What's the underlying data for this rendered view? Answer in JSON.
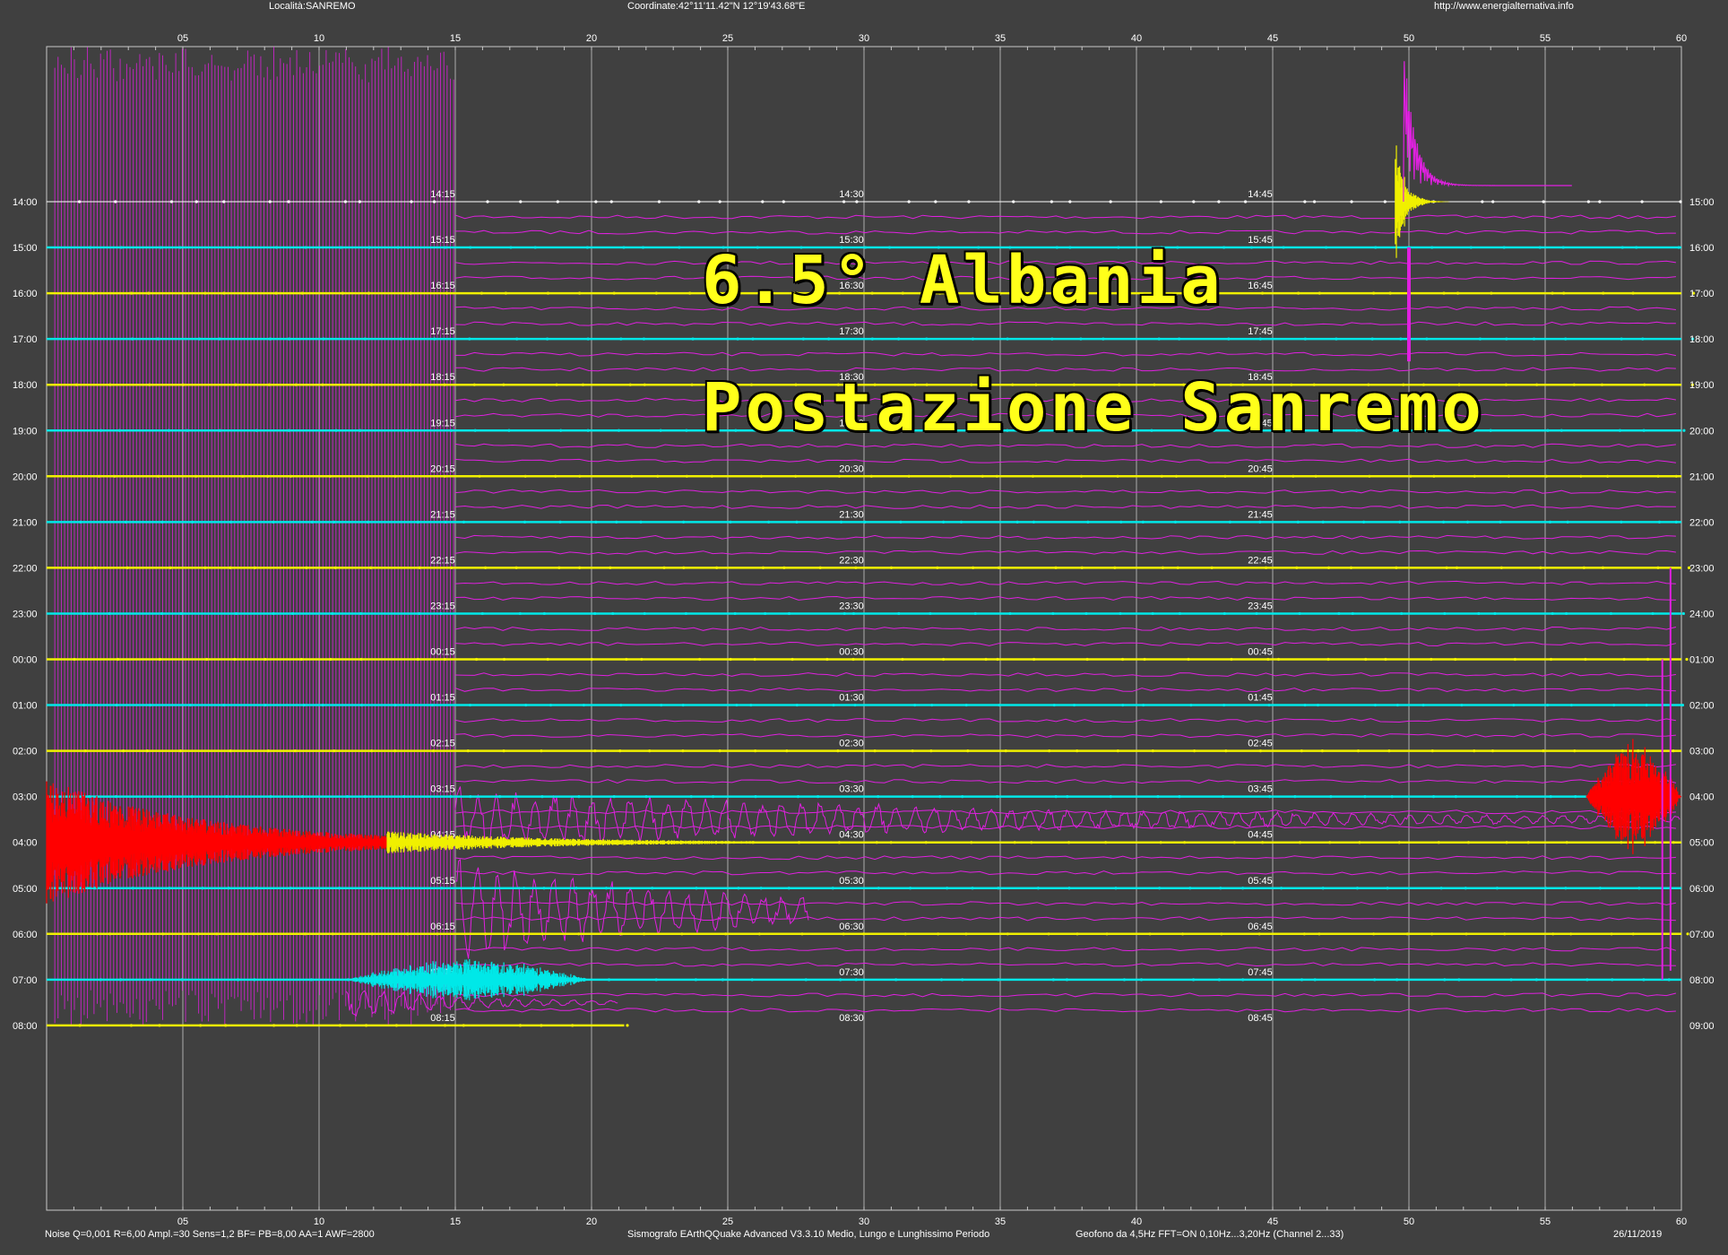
{
  "header": {
    "location": "Località:SANREMO",
    "coordinates": "Coordinate:42°11'11.42\"N  12°19'43.68\"E",
    "url": "http://www.energialternativa.info"
  },
  "footer": {
    "settings": "Noise Q=0,001 R=6,00 Ampl.=30 Sens=1,2 BF= PB=8,00 AA=1 AWF=2800",
    "software": "Sismografo  EArthQQuake Advanced V3.3.10  Medio, Lungo e Lunghissimo Periodo",
    "sensor": "Geofono da 4,5Hz FFT=ON 0,10Hz...3,20Hz      (Channel 2...33)",
    "date": "26/11/2019"
  },
  "overlay": {
    "line1": "6.5° Albania",
    "line2": "Postazione Sanremo"
  },
  "colors": {
    "background": "#404040",
    "grid": "#c8c8c8",
    "trace_magenta": "#e020e0",
    "trace_cyan": "#00e8e8",
    "trace_yellow": "#f0f000",
    "event_red": "#ff0000",
    "overlay_text": "#ffff1a"
  },
  "chart_data": {
    "type": "line",
    "x_ticks": [
      "05",
      "10",
      "15",
      "20",
      "25",
      "30",
      "35",
      "40",
      "45",
      "50",
      "55",
      "60"
    ],
    "xlim": [
      0,
      60
    ],
    "hour_rows_left": [
      "14:00",
      "15:00",
      "16:00",
      "17:00",
      "18:00",
      "19:00",
      "20:00",
      "21:00",
      "22:00",
      "23:00",
      "00:00",
      "01:00",
      "02:00",
      "03:00",
      "04:00",
      "05:00",
      "06:00",
      "07:00",
      "08:00"
    ],
    "hour_rows_right": [
      "15:00",
      "16:00",
      "17:00",
      "18:00",
      "19:00",
      "20:00",
      "21:00",
      "22:00",
      "23:00",
      "24:00",
      "01:00",
      "02:00",
      "03:00",
      "04:00",
      "05:00",
      "06:00",
      "07:00",
      "08:00",
      "09:00"
    ],
    "quarter_labels": [
      [
        "14:15",
        "14:30",
        "14:45"
      ],
      [
        "15:15",
        "15:30",
        "15:45"
      ],
      [
        "16:15",
        "16:30",
        "16:45"
      ],
      [
        "17:15",
        "17:30",
        "17:45"
      ],
      [
        "18:15",
        "18:30",
        "18:45"
      ],
      [
        "19:15",
        "19:30",
        "19:45"
      ],
      [
        "20:15",
        "20:30",
        "20:45"
      ],
      [
        "21:15",
        "21:30",
        "21:45"
      ],
      [
        "22:15",
        "22:30",
        "22:45"
      ],
      [
        "23:15",
        "23:30",
        "23:45"
      ],
      [
        "00:15",
        "00:30",
        "00:45"
      ],
      [
        "01:15",
        "01:30",
        "01:45"
      ],
      [
        "02:15",
        "02:30",
        "02:45"
      ],
      [
        "03:15",
        "03:30",
        "03:45"
      ],
      [
        "04:15",
        "04:30",
        "04:45"
      ],
      [
        "05:15",
        "05:30",
        "05:45"
      ],
      [
        "06:15",
        "06:30",
        "06:45"
      ],
      [
        "07:15",
        "07:30",
        "07:45"
      ],
      [
        "08:15",
        "08:30",
        "08:45"
      ]
    ],
    "row_colors": [
      "white",
      "cyan",
      "yellow",
      "cyan",
      "yellow",
      "cyan",
      "yellow",
      "cyan",
      "yellow",
      "cyan",
      "yellow",
      "cyan",
      "yellow",
      "cyan",
      "yellow",
      "cyan",
      "yellow",
      "cyan",
      "yellow"
    ],
    "last_row_end_minute": 21.2,
    "events": [
      {
        "row": 0,
        "minute_start": 49.5,
        "minute_end": 51.5,
        "amplitude": 1.6,
        "color": "yellow",
        "kind": "spike"
      },
      {
        "row": 13,
        "minute_start": 56.5,
        "minute_end": 60,
        "amplitude": 1.4,
        "color": "red",
        "kind": "burst"
      },
      {
        "row": 14,
        "minute_start": 0,
        "minute_end": 12.5,
        "amplitude": 1.4,
        "color": "red",
        "kind": "decay"
      },
      {
        "row": 14,
        "minute_start": 12.5,
        "minute_end": 26,
        "amplitude": 0.25,
        "color": "yellow",
        "kind": "decay"
      },
      {
        "row": 17,
        "minute_start": 11,
        "minute_end": 20,
        "amplitude": 0.5,
        "color": "cyan",
        "kind": "burst"
      }
    ]
  }
}
